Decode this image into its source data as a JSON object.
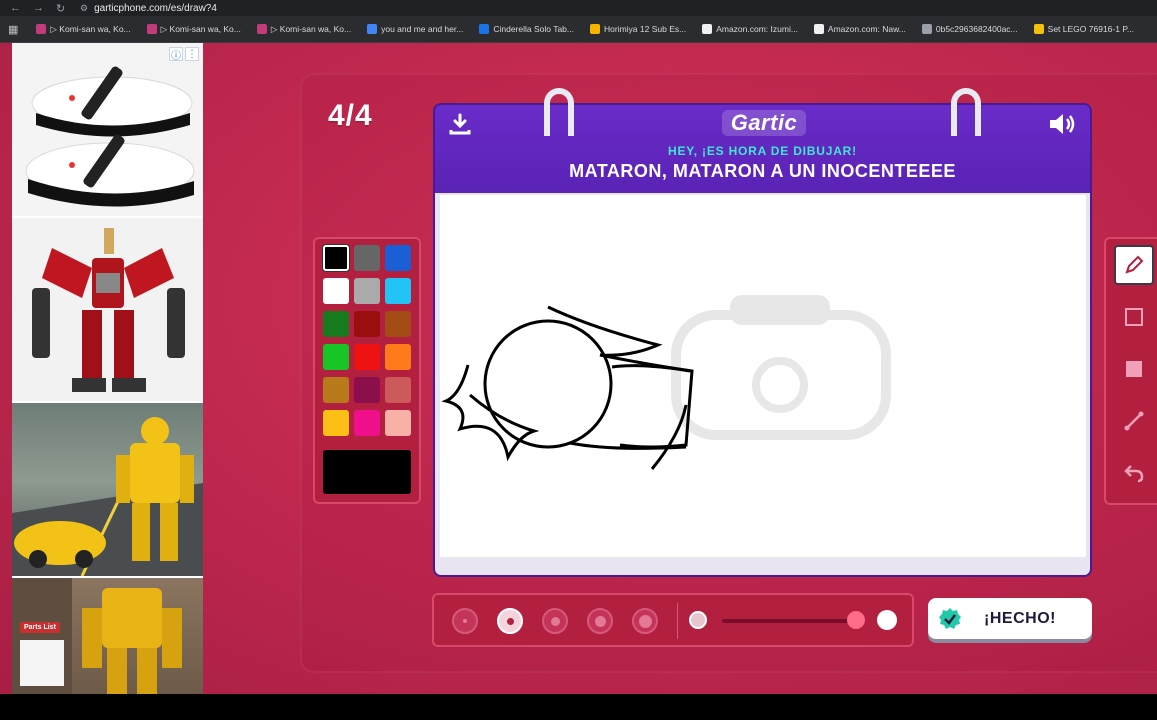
{
  "browser": {
    "url": "garticphone.com/es/draw?4",
    "bookmarks": [
      {
        "label": "▷ Komi-san wa, Ko...",
        "color": "#c23b7a"
      },
      {
        "label": "▷ Komi-san wa, Ko...",
        "color": "#c23b7a"
      },
      {
        "label": "▷ Komi-san wa, Ko...",
        "color": "#c23b7a"
      },
      {
        "label": "you and me and her...",
        "color": "#4285f4"
      },
      {
        "label": "Cinderella Solo Tab...",
        "color": "#1a73e8"
      },
      {
        "label": "Horimiya 12 Sub Es...",
        "color": "#f4b400"
      },
      {
        "label": "Amazon.com: Izumi...",
        "color": "#f0f0f0"
      },
      {
        "label": "Amazon.com: Naw...",
        "color": "#f0f0f0"
      },
      {
        "label": "0b5c2963682400ac...",
        "color": "#9aa0a6"
      },
      {
        "label": "Set LEGO 76916-1 P...",
        "color": "#f4c20d"
      }
    ]
  },
  "ads": {
    "badge_info": "ⓘ",
    "badge_more": "⋮",
    "parts_list_label": "Parts List"
  },
  "game": {
    "round": "4/4",
    "logo": "Gartic",
    "hint": "HEY, ¡ES HORA DE DIBUJAR!",
    "phrase": "MATARON, MATARON A UN INOCENTEEEE",
    "done_label": "¡HECHO!",
    "palette": [
      "#000000",
      "#666666",
      "#1a5fd6",
      "#ffffff",
      "#aaaaaa",
      "#22c4f5",
      "#167a1e",
      "#9b0e0e",
      "#a34c16",
      "#17c426",
      "#ef1212",
      "#ff7a1a",
      "#b87a1a",
      "#8a0f4a",
      "#cc5a5a",
      "#fbbf16",
      "#ef0f8a",
      "#f9b0a6"
    ],
    "selected_color": "#000000",
    "brush_sizes": 5,
    "active_brush_index": 1
  }
}
